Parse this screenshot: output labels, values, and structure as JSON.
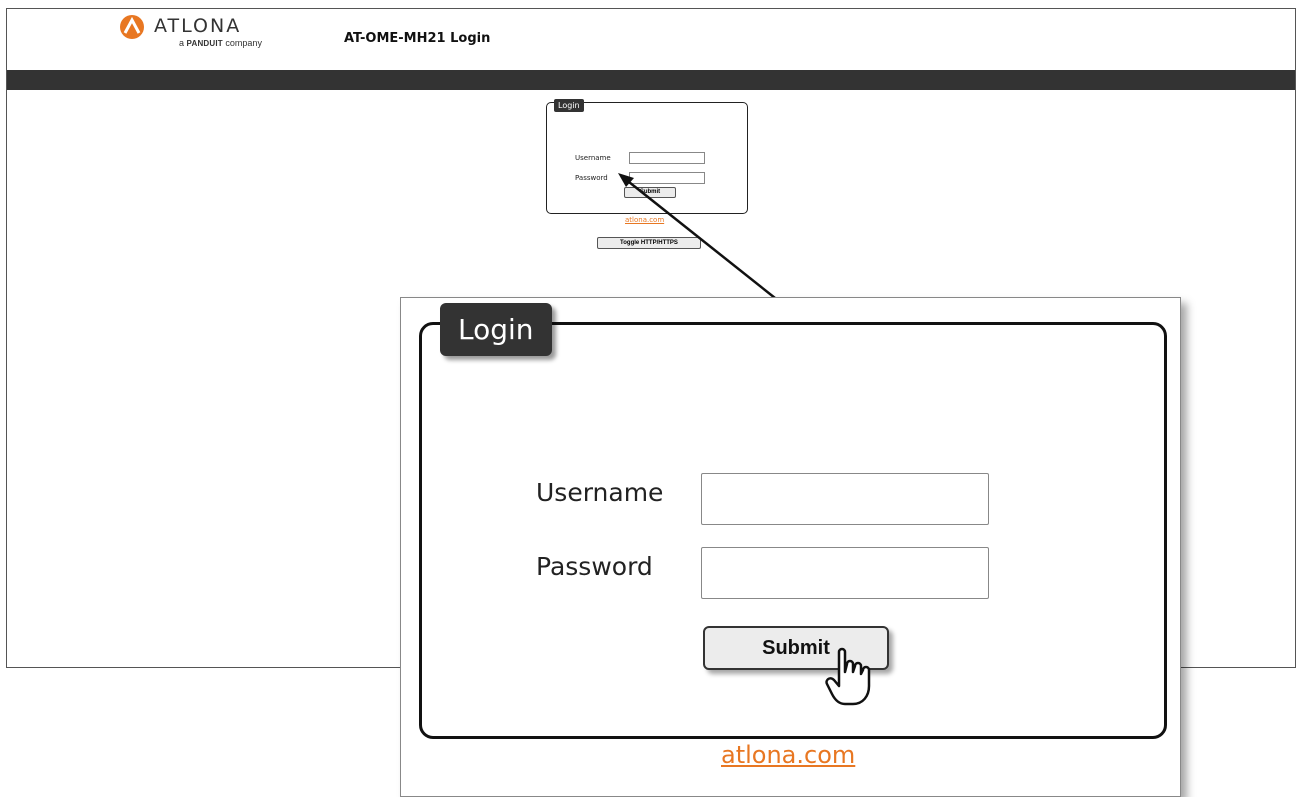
{
  "header": {
    "brand": "ATLONA",
    "tagline_prefix": "a",
    "tagline_brand": "PANDUIT",
    "tagline_suffix": "company",
    "page_title": "AT-OME-MH21  Login"
  },
  "login": {
    "legend": "Login",
    "username_label": "Username",
    "password_label": "Password",
    "username_value": "",
    "password_value": "",
    "submit_label": "Submit",
    "link_text": "atlona.com",
    "toggle_label": "Toggle HTTP/HTTPS"
  },
  "callout": {
    "legend": "Login",
    "username_label": "Username",
    "password_label": "Password",
    "submit_label": "Submit",
    "link_text": "atlona.com"
  },
  "colors": {
    "brand_orange": "#e87722",
    "navbar": "#333333",
    "legend_bg": "#333333"
  },
  "icons": {
    "logo": "atlona-logo-icon",
    "pointer": "hand-pointer-icon",
    "arrow": "callout-arrow-icon"
  }
}
